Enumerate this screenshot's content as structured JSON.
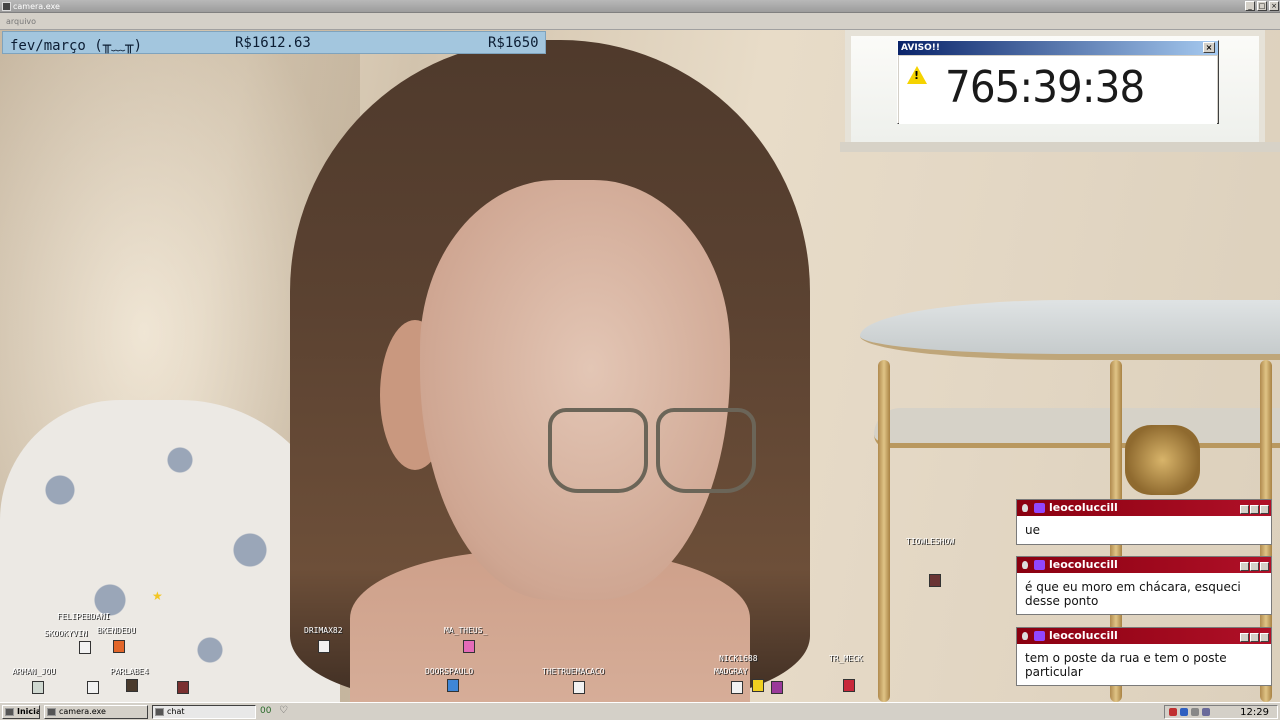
{
  "window": {
    "title": "camera.exe",
    "menu": "arquivo"
  },
  "goal_bar": {
    "label": "fev/março (╥﹏╥)",
    "current": "R$1612.63",
    "target": "R$1650",
    "progress": 0.977
  },
  "aviso": {
    "title": "AVISO!!",
    "timer": "765:39:38"
  },
  "chats": [
    {
      "user": "leocoluccill",
      "message": "ue"
    },
    {
      "user": "leocoluccill",
      "message": "é que eu moro em chácara, esqueci desse ponto"
    },
    {
      "user": "leocoluccill",
      "message": "tem o poste da rua e tem o poste particular"
    }
  ],
  "viewers": [
    {
      "name": "FELIPEBDANI"
    },
    {
      "name": "SKOOKYVIN"
    },
    {
      "name": "BKENDEDU"
    },
    {
      "name": "ARMAN_JOU"
    },
    {
      "name": "PARLABE4"
    },
    {
      "name": "DRIMAX82"
    },
    {
      "name": "MA_THEUS_"
    },
    {
      "name": "DOORSPAULO"
    },
    {
      "name": "THETRUEMACACO"
    },
    {
      "name": "NICK1688"
    },
    {
      "name": "MADGRAY"
    },
    {
      "name": "TR_MECK"
    },
    {
      "name": "TIOWLESHOW"
    }
  ],
  "taskbar": {
    "start_label": "Iniciar",
    "items": [
      "camera.exe",
      "chat"
    ],
    "quick": "00",
    "clock": "12:29"
  },
  "colors": {
    "goal_bg": "#a3c6de",
    "chat_titlebar": "#9a0a1c",
    "dialog_titlebar": "#0a246a"
  }
}
